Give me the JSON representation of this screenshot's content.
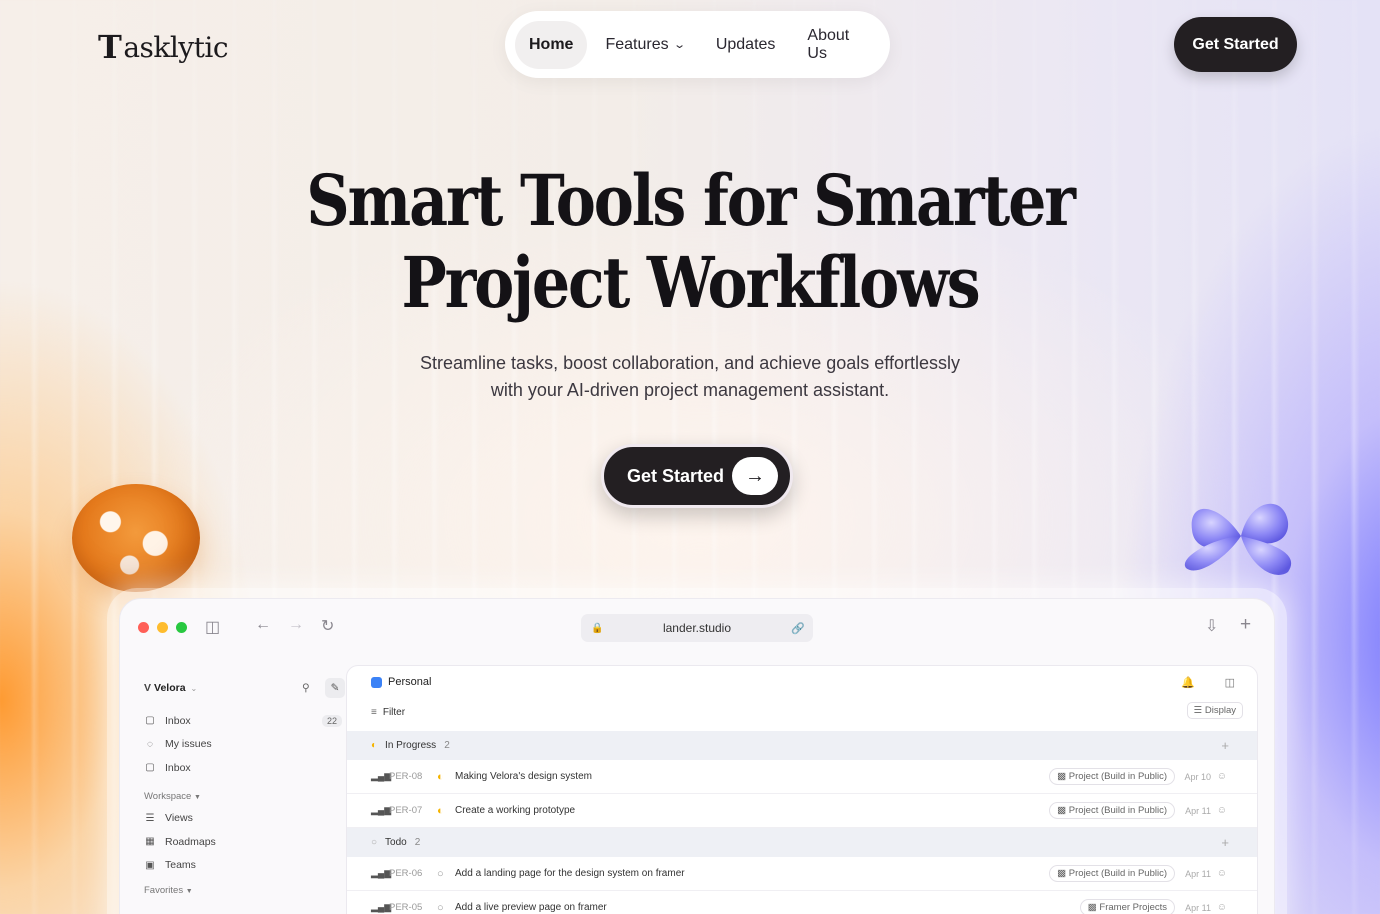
{
  "brand": {
    "logo_mark": "T",
    "logo_text": "asklytic"
  },
  "nav": {
    "items": [
      {
        "label": "Home",
        "active": true
      },
      {
        "label": "Features",
        "has_dropdown": true
      },
      {
        "label": "Updates"
      },
      {
        "label": "About Us"
      }
    ],
    "cta": "Get Started"
  },
  "hero": {
    "title_line1": "Smart Tools for Smarter",
    "title_line2": "Project Workflows",
    "subtitle_line1": "Streamline tasks, boost collaboration, and achieve goals effortlessly",
    "subtitle_line2": "with your AI-driven project management assistant.",
    "cta": "Get Started",
    "cta_icon": "arrow-right-icon"
  },
  "browser": {
    "url": "lander.studio",
    "traffic_lights": [
      "#ff5f57",
      "#febc2e",
      "#28c840"
    ]
  },
  "app": {
    "workspace_name": "Velora",
    "sidebar": {
      "top_items": [
        {
          "label": "Inbox",
          "badge": "22",
          "icon": "inbox-icon"
        },
        {
          "label": "My issues",
          "icon": "issues-icon"
        },
        {
          "label": "Inbox",
          "icon": "inbox-icon"
        }
      ],
      "workspace_section": "Workspace",
      "workspace_items": [
        {
          "label": "Views",
          "icon": "layers-icon"
        },
        {
          "label": "Roadmaps",
          "icon": "map-icon"
        },
        {
          "label": "Teams",
          "icon": "team-icon"
        }
      ],
      "favorites_section": "Favorites"
    },
    "main": {
      "title": "Personal",
      "filter": "Filter",
      "display": "Display",
      "groups": [
        {
          "name": "In Progress",
          "count": "2",
          "rows": [
            {
              "id": "PER-08",
              "title": "Making Velora's design system",
              "tag": "Project (Build in Public)",
              "date": "Apr 10"
            },
            {
              "id": "PER-07",
              "title": "Create a working prototype",
              "tag": "Project (Build in Public)",
              "date": "Apr 11"
            }
          ]
        },
        {
          "name": "Todo",
          "count": "2",
          "rows": [
            {
              "id": "PER-06",
              "title": "Add a landing page for the design system on framer",
              "tag": "Project (Build in Public)",
              "date": "Apr 11"
            },
            {
              "id": "PER-05",
              "title": "Add a live preview page on framer",
              "tag": "Framer Projects",
              "date": "Apr 11"
            }
          ]
        }
      ]
    }
  },
  "colors": {
    "dark": "#231f22",
    "accent_orange": "#f39a3c",
    "accent_purple": "#7b7cff"
  }
}
